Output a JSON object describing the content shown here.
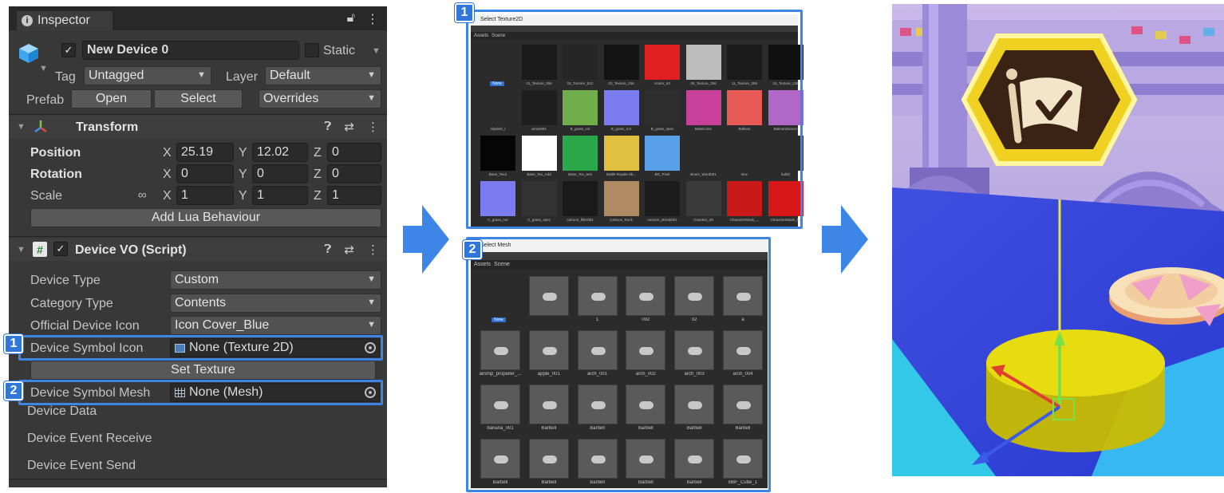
{
  "inspector": {
    "tab_label": "Inspector",
    "object_name": "New Device 0",
    "static_label": "Static",
    "tag_label": "Tag",
    "tag_value": "Untagged",
    "layer_label": "Layer",
    "layer_value": "Default",
    "prefab_label": "Prefab",
    "open_btn": "Open",
    "select_btn": "Select",
    "overrides_btn": "Overrides",
    "transform": {
      "title": "Transform",
      "position_label": "Position",
      "rotation_label": "Rotation",
      "scale_label": "Scale",
      "axis_x": "X",
      "axis_y": "Y",
      "axis_z": "Z",
      "pos_x": "25.19",
      "pos_y": "12.02",
      "pos_z": "0",
      "rot_x": "0",
      "rot_y": "0",
      "rot_z": "0",
      "scale_x": "1",
      "scale_y": "1",
      "scale_z": "1",
      "add_lua_btn": "Add Lua Behaviour"
    },
    "device_vo": {
      "title": "Device VO (Script)",
      "device_type_label": "Device Type",
      "device_type_value": "Custom",
      "category_type_label": "Category Type",
      "category_type_value": "Contents",
      "official_icon_label": "Official Device Icon",
      "official_icon_value": "Icon Cover_Blue",
      "symbol_icon_label": "Device Symbol Icon",
      "symbol_icon_value": "None (Texture 2D)",
      "set_texture_btn": "Set Texture",
      "symbol_mesh_label": "Device Symbol Mesh",
      "symbol_mesh_value": "None (Mesh)",
      "device_data_label": "Device Data",
      "event_receive_label": "Device Event Receive",
      "event_send_label": "Device Event Send"
    }
  },
  "badges": {
    "one": "1",
    "two": "2"
  },
  "texture_panel": {
    "title": "Select Texture2D",
    "tabs": [
      "Assets",
      "Scene"
    ],
    "items": [
      {
        "label": "None",
        "color": "#2b2b2b"
      },
      {
        "label": "01_Texture_256",
        "color": "#1a1a1a"
      },
      {
        "label": "02_Texture_512",
        "color": "#262626"
      },
      {
        "label": "03_Texture_256",
        "color": "#141414"
      },
      {
        "label": "4color_64",
        "color": "#e02020"
      },
      {
        "label": "08_Texture_256",
        "color": "#bdbdbd"
      },
      {
        "label": "11_Texture_256",
        "color": "#1a1a1a"
      },
      {
        "label": "15_Texture_128",
        "color": "#101010"
      },
      {
        "label": "Alpabet_I",
        "color": "#2b2b2b"
      },
      {
        "label": "arrow001",
        "color": "#1e1e1e"
      },
      {
        "label": "B_grass_col",
        "color": "#6fae4a"
      },
      {
        "label": "B_grass_nor",
        "color": "#7a7cf0"
      },
      {
        "label": "B_grass_spec",
        "color": "#2e2e2e"
      },
      {
        "label": "BakeColor",
        "color": "#c8409a"
      },
      {
        "label": "Balloon",
        "color": "#e85a55"
      },
      {
        "label": "BalloonDancer",
        "color": "#b067c8"
      },
      {
        "label": "Base_Tex2",
        "color": "#050505"
      },
      {
        "label": "Base_Tex_Add",
        "color": "#ffffff"
      },
      {
        "label": "Base_Tex_test",
        "color": "#2aa84a"
      },
      {
        "label": "Battle Royale Sk...",
        "color": "#e0c040"
      },
      {
        "label": "BG_Pixel",
        "color": "#5aa0e8"
      },
      {
        "label": "Boom_Word001",
        "color": "#2b2b2b"
      },
      {
        "label": "Box",
        "color": "#2b2b2b"
      },
      {
        "label": "bubl2",
        "color": "#2b2b2b"
      },
      {
        "label": "C_grass_nor",
        "color": "#7a7cf0"
      },
      {
        "label": "C_grass_spec",
        "color": "#333333"
      },
      {
        "label": "cartoon_filter001",
        "color": "#1a1a1a"
      },
      {
        "label": "Cartoon_Rock",
        "color": "#b08a62"
      },
      {
        "label": "cartoon_streak001",
        "color": "#1c1c1c"
      },
      {
        "label": "Caustics_00",
        "color": "#3a3a3a"
      },
      {
        "label": "CharacterMask_...",
        "color": "#c81818"
      },
      {
        "label": "CharacterMask_01",
        "color": "#d81818"
      }
    ]
  },
  "mesh_panel": {
    "title": "Select Mesh",
    "tabs": [
      "Assets",
      "Scene"
    ],
    "items": [
      {
        "label": "None"
      },
      {
        "label": ""
      },
      {
        "label": "1"
      },
      {
        "label": "002"
      },
      {
        "label": "02"
      },
      {
        "label": "a"
      },
      {
        "label": "airship_propeller_..."
      },
      {
        "label": "apple_001"
      },
      {
        "label": "arch_001"
      },
      {
        "label": "arch_002"
      },
      {
        "label": "arch_003"
      },
      {
        "label": "arch_004"
      },
      {
        "label": "banana_001"
      },
      {
        "label": "Barbell"
      },
      {
        "label": "Barbell"
      },
      {
        "label": "Barbell"
      },
      {
        "label": "Barbell"
      },
      {
        "label": "Barbell"
      },
      {
        "label": "Barbell"
      },
      {
        "label": "Barbell"
      },
      {
        "label": "Barbell"
      },
      {
        "label": "Barbell"
      },
      {
        "label": "Barbell"
      },
      {
        "label": "BBF_Cube_1"
      }
    ]
  },
  "colors": {
    "accent": "#3d86e8",
    "badge": "#2f77db"
  }
}
